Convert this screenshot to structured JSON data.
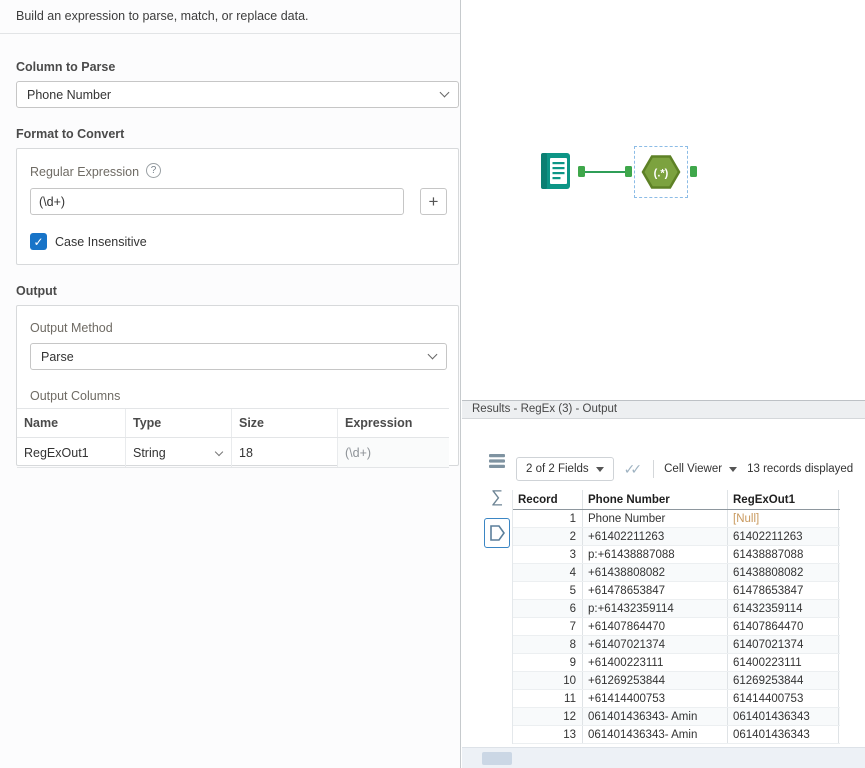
{
  "config": {
    "intro": "Build an expression to parse, match, or replace data.",
    "column_to_parse": {
      "label": "Column to Parse",
      "value": "Phone Number"
    },
    "format": {
      "label": "Format to Convert",
      "regex_label": "Regular Expression",
      "regex_value": "(\\d+)",
      "case_insensitive": {
        "label": "Case Insensitive",
        "checked": true
      }
    },
    "output": {
      "label": "Output",
      "method_label": "Output Method",
      "method_value": "Parse",
      "columns_label": "Output Columns",
      "columns_table": {
        "headers": [
          "Name",
          "Type",
          "Size",
          "Expression"
        ],
        "row": {
          "name": "RegExOut1",
          "type": "String",
          "size": "18",
          "expression": "(\\d+)"
        }
      }
    }
  },
  "canvas": {
    "regex_icon_text": "(.*)"
  },
  "results": {
    "title": "Results - RegEx (3) - Output",
    "toolbar": {
      "fields": "2 of 2 Fields",
      "cell_viewer": "Cell Viewer",
      "records": "13 records displayed"
    },
    "grid": {
      "headers": [
        "Record",
        "Phone Number",
        "RegExOut1"
      ],
      "rows": [
        {
          "record": "1",
          "phone": "Phone Number",
          "out": "[Null]"
        },
        {
          "record": "2",
          "phone": "+61402211263",
          "out": "61402211263"
        },
        {
          "record": "3",
          "phone": "p:+61438887088",
          "out": "61438887088"
        },
        {
          "record": "4",
          "phone": "+61438808082",
          "out": "61438808082"
        },
        {
          "record": "5",
          "phone": "+61478653847",
          "out": "61478653847"
        },
        {
          "record": "6",
          "phone": "p:+61432359114",
          "out": "61432359114"
        },
        {
          "record": "7",
          "phone": "+61407864470",
          "out": "61407864470"
        },
        {
          "record": "8",
          "phone": "+61407021374",
          "out": "61407021374"
        },
        {
          "record": "9",
          "phone": "+61400223111",
          "out": "61400223111"
        },
        {
          "record": "10",
          "phone": "+61269253844",
          "out": "61269253844"
        },
        {
          "record": "11",
          "phone": "+61414400753",
          "out": "61414400753"
        },
        {
          "record": "12",
          "phone": "061401436343- Amin",
          "out": "061401436343"
        },
        {
          "record": "13",
          "phone": "061401436343- Amin",
          "out": "061401436343"
        }
      ]
    }
  },
  "colors": {
    "accent_blue": "#1874c8",
    "tool_hexagon_green": "#7ca23f",
    "connection_green": "#2f9e57",
    "text_input_teal": "#0d9586",
    "null_text": "#c9995e"
  },
  "icons": {
    "help": "?",
    "plus": "+",
    "check": "✓",
    "double_check": "✓✓",
    "sigma": "∑"
  }
}
